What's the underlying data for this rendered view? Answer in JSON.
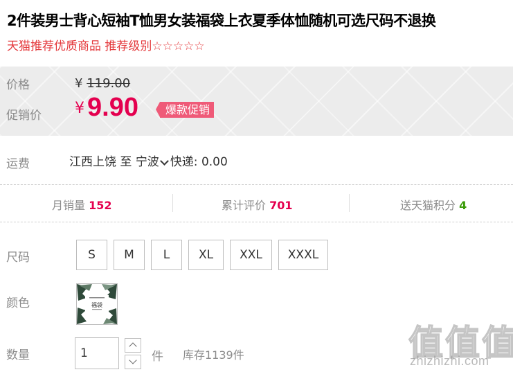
{
  "product": {
    "title": "2件装男士背心短袖T恤男女装福袋上衣夏季体恤随机可选尺码不退换",
    "subtitle": "天猫推荐优质商品 推荐级别",
    "rating_stars": "☆☆☆☆☆"
  },
  "price": {
    "orig_label": "价格",
    "currency": "¥",
    "orig_value": "119.00",
    "promo_label": "促销价",
    "promo_value": "9.90",
    "promo_tag": "爆款促销"
  },
  "shipping": {
    "label": "运费",
    "from": "江西上饶",
    "to_word": "至",
    "destination": "宁波",
    "method": "快递: 0.00"
  },
  "stats": {
    "monthly_sales_label": "月销量",
    "monthly_sales": "152",
    "reviews_label": "累计评价",
    "reviews": "701",
    "points_label": "送天猫积分",
    "points": "4"
  },
  "sizes": {
    "label": "尺码",
    "options": [
      "S",
      "M",
      "L",
      "XL",
      "XXL",
      "XXXL"
    ]
  },
  "color": {
    "label": "颜色",
    "swatch_text": "福袋"
  },
  "quantity": {
    "label": "数量",
    "value": "1",
    "unit": "件",
    "stock": "库存1139件"
  },
  "watermark": {
    "glyphs": "值值值",
    "url": "zhizhizhi.com"
  },
  "colors": {
    "accent": "#e4004f",
    "promo_tag_bg": "#ef5a78",
    "points_green": "#3b9b0a"
  }
}
